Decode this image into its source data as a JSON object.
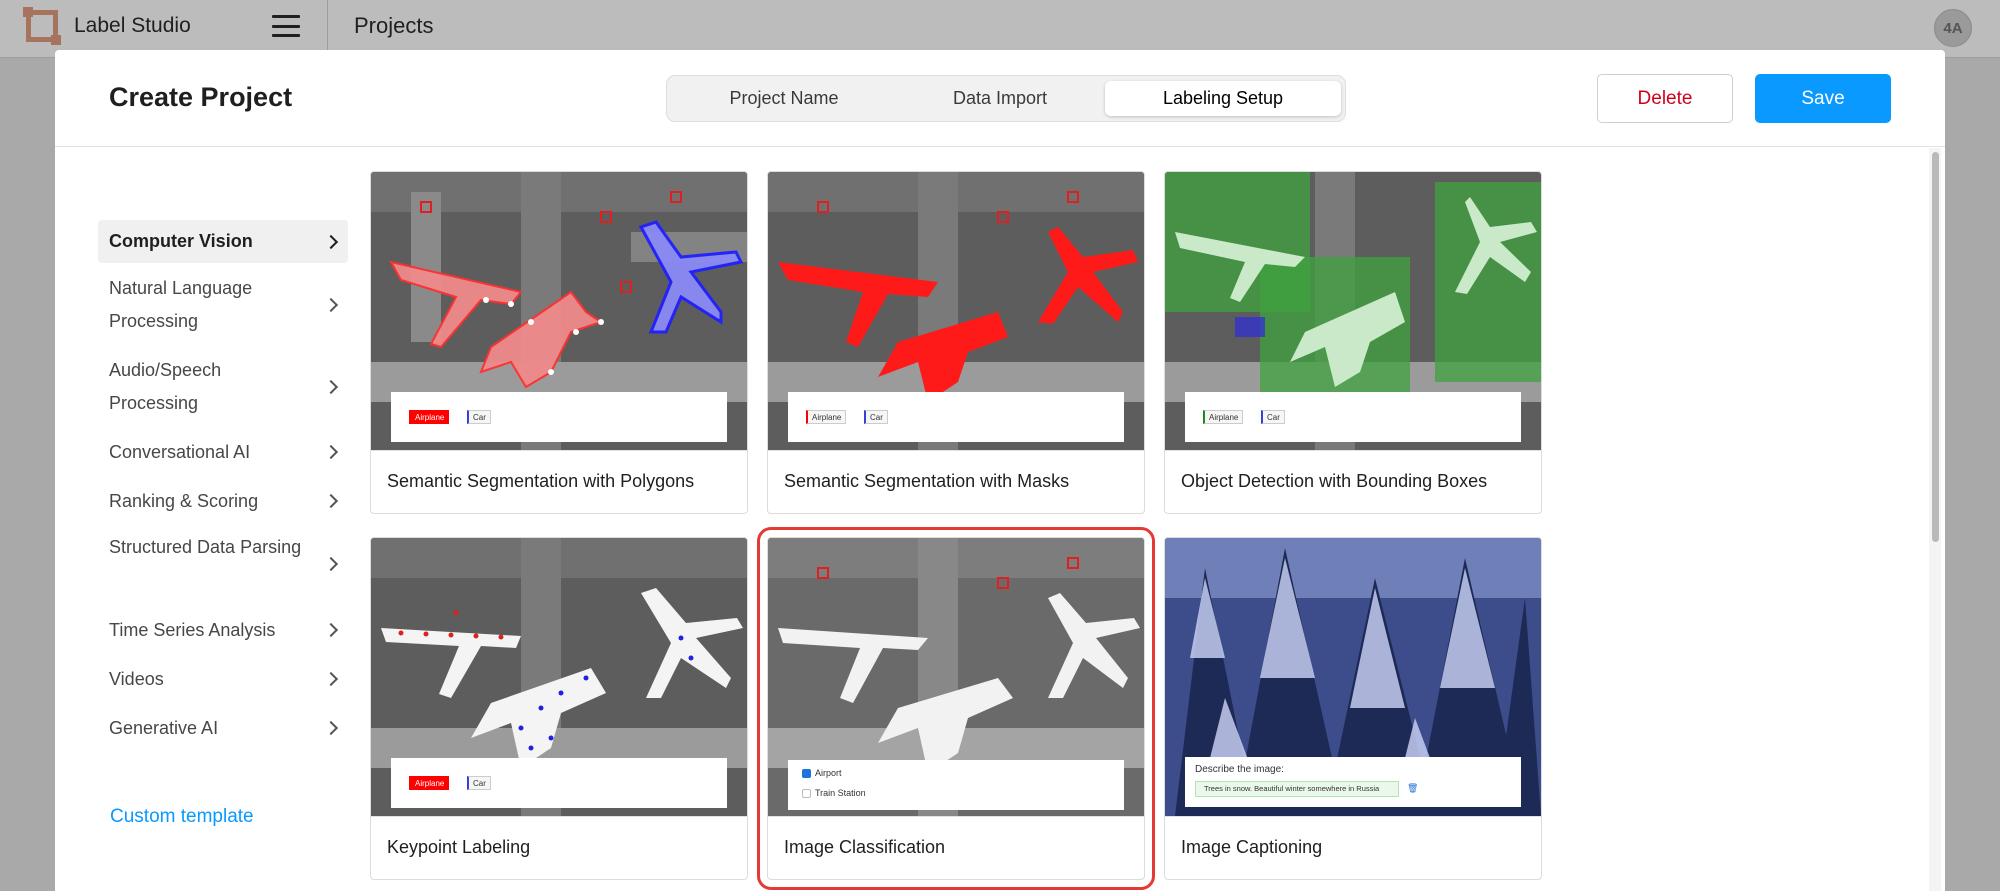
{
  "app": {
    "name": "Label Studio",
    "breadcrumb": "Projects",
    "avatar_initials": "4A"
  },
  "modal": {
    "title": "Create Project",
    "steps": [
      {
        "label": "Project Name",
        "active": false
      },
      {
        "label": "Data Import",
        "active": false
      },
      {
        "label": "Labeling Setup",
        "active": true
      }
    ],
    "delete_label": "Delete",
    "save_label": "Save"
  },
  "sidebar": {
    "items": [
      {
        "label": "Computer Vision",
        "active": true
      },
      {
        "label": "Natural Language Processing",
        "active": false
      },
      {
        "label": "Audio/Speech Processing",
        "active": false
      },
      {
        "label": "Conversational AI",
        "active": false
      },
      {
        "label": "Ranking & Scoring",
        "active": false
      },
      {
        "label": "Structured Data Parsing",
        "active": false
      },
      {
        "label": "Time Series Analysis",
        "active": false
      },
      {
        "label": "Videos",
        "active": false
      },
      {
        "label": "Generative AI",
        "active": false
      }
    ],
    "custom_template": "Custom template"
  },
  "templates": [
    {
      "name": "Semantic Segmentation with Polygons",
      "labels": [
        "Airplane",
        "Car"
      ]
    },
    {
      "name": "Semantic Segmentation with Masks",
      "labels": [
        "Airplane",
        "Car"
      ]
    },
    {
      "name": "Object Detection with Bounding Boxes",
      "labels": [
        "Airplane",
        "Car"
      ]
    },
    {
      "name": "Keypoint Labeling",
      "labels": [
        "Airplane",
        "Car"
      ]
    },
    {
      "name": "Image Classification",
      "choices": [
        "Airport",
        "Train Station"
      ],
      "selected": true
    },
    {
      "name": "Image Captioning",
      "prompt": "Describe the image:",
      "caption": "Trees in snow. Beautiful winter somewhere in Russia"
    }
  ],
  "colors": {
    "accent": "#0999ff",
    "danger": "#d0021b",
    "selection": "#e53935"
  }
}
